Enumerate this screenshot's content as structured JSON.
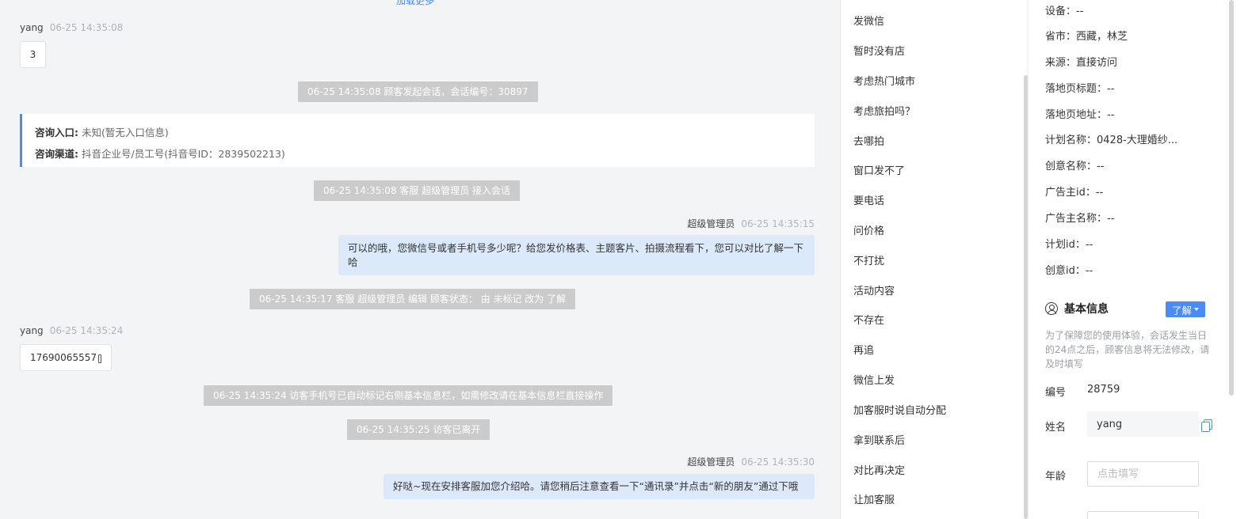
{
  "chat": {
    "load_more": "加载更多",
    "msg1": {
      "sender": "yang",
      "time": "06-25 14:35:08",
      "text": "3"
    },
    "sys1": "06-25 14:35:08 顾客发起会话，会话编号：30897",
    "consult": {
      "entry_label": "咨询入口:",
      "entry_value": "未知(暂无入口信息)",
      "channel_label": "咨询渠道:",
      "channel_value": "抖音企业号/员工号(抖音号ID：2839502213)"
    },
    "sys2": "06-25 14:35:08 客服 超级管理员 接入会话",
    "msg2": {
      "sender": "超级管理员",
      "time": "06-25 14:35:15",
      "text": "可以的哦，您微信号或者手机号多少呢？给您发价格表、主题客片、拍摄流程看下，您可以对比了解一下哈"
    },
    "sys3": "06-25 14:35:17 客服 超级管理员 编辑 顾客状态： 由 未标记 改为 了解",
    "msg3": {
      "sender": "yang",
      "time": "06-25 14:35:24",
      "text": "17690065557"
    },
    "sys4": "06-25 14:35:24 访客手机号已自动标记右侧基本信息栏，如需修改请在基本信息栏直接操作",
    "sys5": "06-25 14:35:25 访客已离开",
    "msg4": {
      "sender": "超级管理员",
      "time": "06-25 14:35:30",
      "text": "好哒~现在安排客服加您介绍哈。请您稍后注意查看一下“通讯录”并点击“新的朋友”通过下哦"
    }
  },
  "quick_replies": [
    "发微信",
    "暂时没有店",
    "考虑热门城市",
    "考虑旅拍吗？",
    "去哪拍",
    "窗口发不了",
    "要电话",
    "问价格",
    "不打扰",
    "活动内容",
    "不存在",
    "再追",
    "微信上发",
    "加客服时说自动分配",
    "拿到联系后",
    "对比再决定",
    "让加客服"
  ],
  "visitor_info": [
    {
      "label": "设备：",
      "value": "--"
    },
    {
      "label": "省市：",
      "value": "西藏，林芝"
    },
    {
      "label": "来源：",
      "value": "直接访问"
    },
    {
      "label": "落地页标题：",
      "value": "--"
    },
    {
      "label": "落地页地址：",
      "value": "--"
    },
    {
      "label": "计划名称：",
      "value": "0428-大理婚纱..."
    },
    {
      "label": "创意名称：",
      "value": "--"
    },
    {
      "label": "广告主id：",
      "value": "--"
    },
    {
      "label": "广告主名称：",
      "value": "--"
    },
    {
      "label": "计划id：",
      "value": "--"
    },
    {
      "label": "创意id：",
      "value": "--"
    }
  ],
  "basic_info": {
    "title": "基本信息",
    "status_tag": "了解",
    "notice": "为了保障您的使用体验，会话发生当日的24点之后，顾客信息将无法修改，请及时填写",
    "id_label": "编号",
    "id_value": "28759",
    "name_label": "姓名",
    "name_value": "yang",
    "age_label": "年龄",
    "age_placeholder": "点击填写"
  },
  "colors": {
    "accent": "#4a8bf5",
    "bubble_right": "#dce9fb",
    "system_bg": "#cbcbcb",
    "page_bg": "#f3f4f6"
  }
}
